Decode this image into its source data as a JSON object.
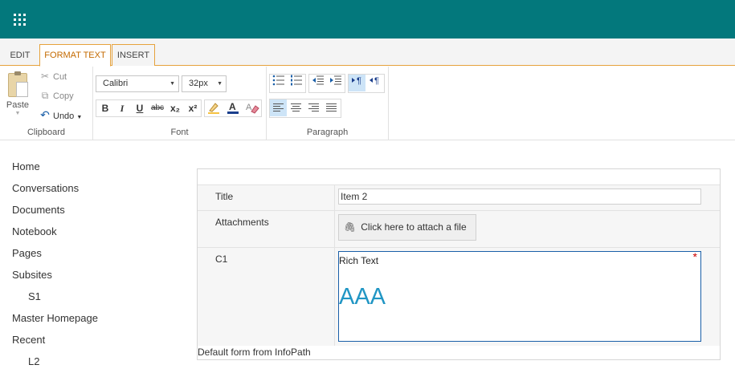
{
  "suite_bar": {
    "waffle_icon": "app-launcher-waffle-icon",
    "bg_color": "#03787c"
  },
  "tabs": [
    {
      "label": "EDIT"
    },
    {
      "label": "FORMAT TEXT"
    },
    {
      "label": "INSERT"
    }
  ],
  "ribbon": {
    "clipboard": {
      "paste": "Paste",
      "cut": "Cut",
      "copy": "Copy",
      "undo": "Undo",
      "group_label": "Clipboard"
    },
    "font": {
      "family": "Calibri",
      "size": "32px",
      "group_label": "Font",
      "buttons": [
        "B",
        "I",
        "U",
        "abc",
        "x₂",
        "x²"
      ]
    },
    "paragraph": {
      "group_label": "Paragraph"
    }
  },
  "nav": {
    "items": [
      {
        "label": "Home"
      },
      {
        "label": "Conversations"
      },
      {
        "label": "Documents"
      },
      {
        "label": "Notebook"
      },
      {
        "label": "Pages"
      },
      {
        "label": "Subsites"
      },
      {
        "label": "S1"
      },
      {
        "label": "Master Homepage"
      },
      {
        "label": "Recent"
      },
      {
        "label": "L2"
      }
    ]
  },
  "form": {
    "title_label": "Title",
    "title_value": "Item 2",
    "attachments_label": "Attachments",
    "attach_button": "Click here to attach a file",
    "c1_label": "C1",
    "rich_text_placeholder": "Rich Text",
    "rich_text_content": "AAA",
    "required_marker": "*",
    "footer": "Default form from InfoPath"
  }
}
